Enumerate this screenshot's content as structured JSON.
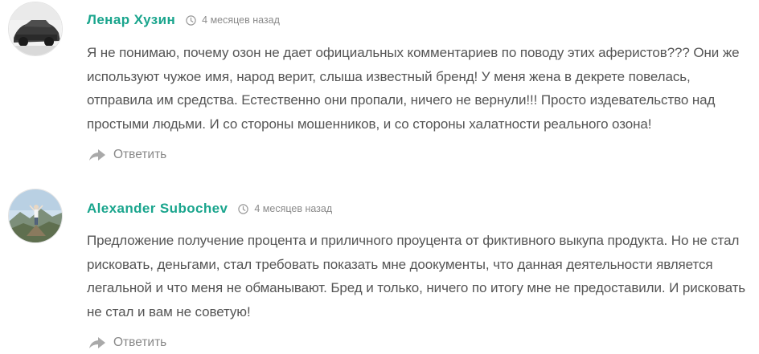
{
  "comments": [
    {
      "author": "Ленар Хузин",
      "date": "4 месяцев назад",
      "text": "Я не понимаю, почему озон не дает официальных комментариев по поводу этих аферистов??? Они же используют чужое имя, народ верит, слыша известный бренд! У меня жена в декрете повелась, отправила им средства. Естественно они пропали, ничего не вернули!!! Просто издевательство над простыми людьми. И со стороны мошенников, и со стороны халатности реального озона!",
      "reply_label": "Ответить",
      "avatar_icon": "user-photo-car"
    },
    {
      "author": "Alexander Subochev",
      "date": "4 месяцев назад",
      "text": "Предложение получение процента и приличного проуцента от фиктивного выкупа продукта. Но не стал рисковать, деньгами, стал требовать показать мне доокументы, что данная деятельности является легальной и что меня не обманывают. Бред и только, ничего по итогу мне не предоставили. И рисковать не стал и вам не советую!",
      "reply_label": "Ответить",
      "avatar_icon": "user-photo-mountain"
    }
  ],
  "colors": {
    "author": "#1aa58d",
    "text": "#555555",
    "meta": "#8a8a8a"
  },
  "icons": {
    "date": "clock-icon",
    "reply": "reply-arrow-icon"
  }
}
